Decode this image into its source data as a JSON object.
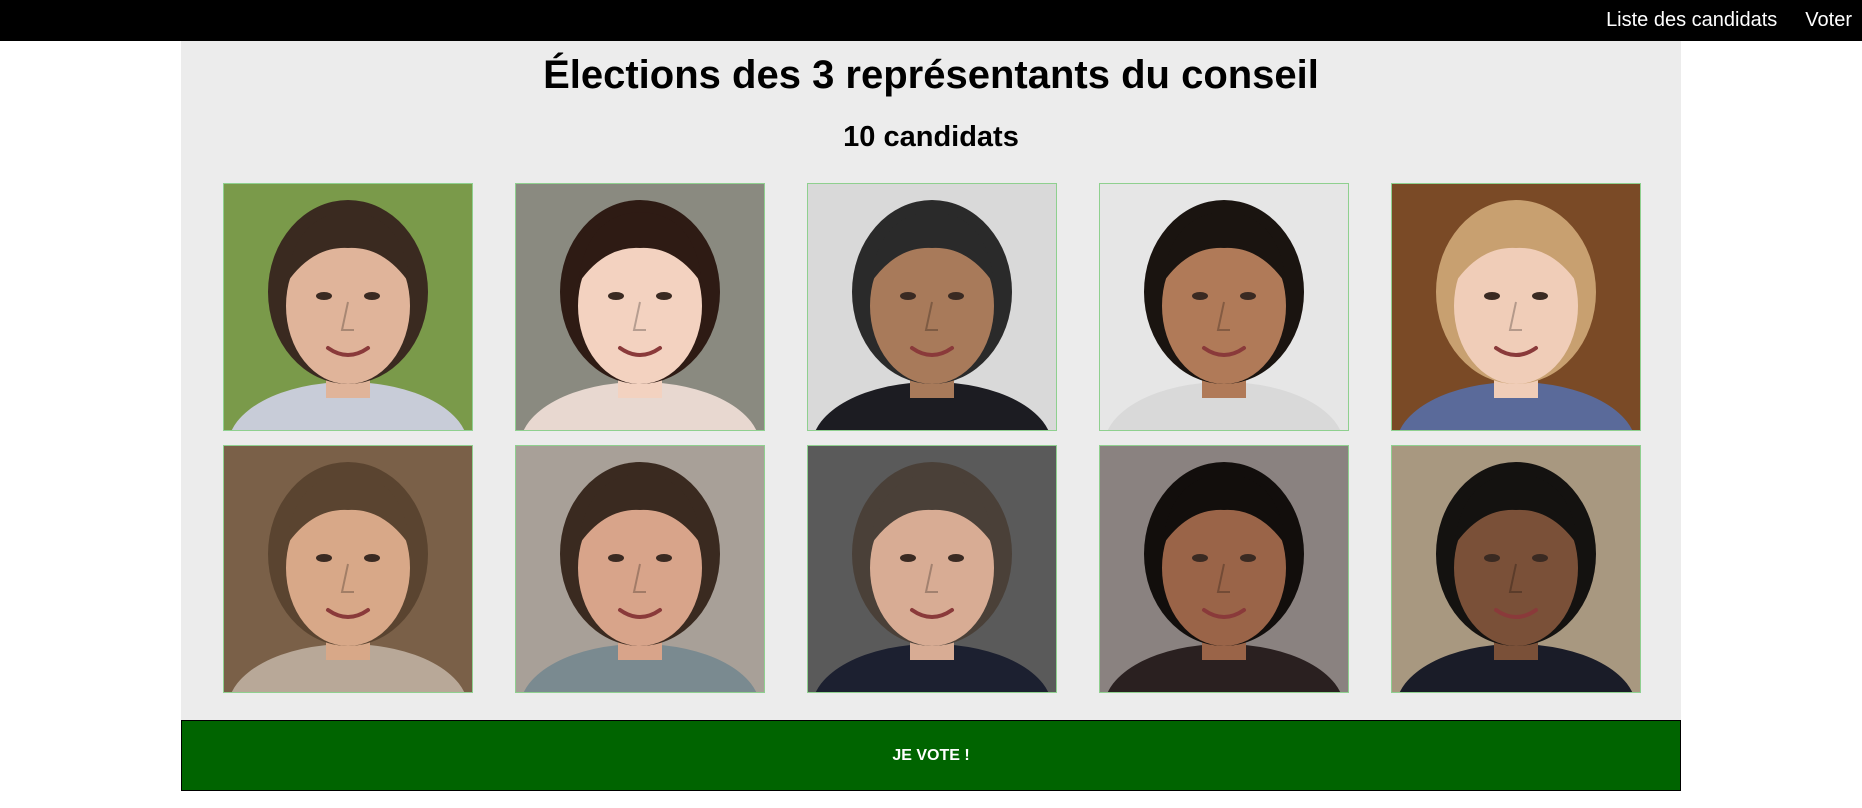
{
  "nav": {
    "candidates_link": "Liste des candidats",
    "vote_link": "Voter"
  },
  "header": {
    "title": "Élections des 3 représentants du conseil",
    "subtitle": "10 candidats"
  },
  "candidates": [
    {
      "photo": "woman-curly-brown-hair-portrait",
      "bg": "#7a9a4a",
      "skin": "#e0b49a",
      "hair": "#3a2a20",
      "shirt": "#c8ccd8"
    },
    {
      "photo": "woman-long-dark-hair-bangs-portrait",
      "bg": "#8a8a80",
      "skin": "#f3d2c0",
      "hair": "#2e1b14",
      "shirt": "#e8d8d0"
    },
    {
      "photo": "man-glasses-mustache-portrait",
      "bg": "#d9d9d9",
      "skin": "#a87a5a",
      "hair": "#2a2a2a",
      "shirt": "#1c1c22"
    },
    {
      "photo": "woman-curly-black-hair-portrait",
      "bg": "#e6e6e6",
      "skin": "#b07a58",
      "hair": "#1a1410",
      "shirt": "#d9d9d9"
    },
    {
      "photo": "woman-blonde-hair-portrait",
      "bg": "#7a4a26",
      "skin": "#f0cdb8",
      "hair": "#c8a070",
      "shirt": "#5a6a9a"
    },
    {
      "photo": "man-short-brown-hair-scarf-portrait",
      "bg": "#7a6048",
      "skin": "#d8a888",
      "hair": "#5a4430",
      "shirt": "#b8a898"
    },
    {
      "photo": "man-glasses-beard-portrait",
      "bg": "#a8a098",
      "skin": "#d8a48a",
      "hair": "#3a2a20",
      "shirt": "#7a8a90"
    },
    {
      "photo": "man-suit-grey-hair-portrait",
      "bg": "#5a5a5a",
      "skin": "#d8ac94",
      "hair": "#4a4038",
      "shirt": "#1c2030"
    },
    {
      "photo": "woman-long-black-hair-earrings-portrait",
      "bg": "#8a8280",
      "skin": "#9a6448",
      "hair": "#120e0c",
      "shirt": "#2a2020"
    },
    {
      "photo": "man-short-black-hair-portrait",
      "bg": "#a89880",
      "skin": "#7a5038",
      "hair": "#141210",
      "shirt": "#1a1c28"
    }
  ],
  "vote_button": {
    "label": "JE VOTE !"
  },
  "colors": {
    "topbar": "#000000",
    "panel": "#ececec",
    "vote_button": "#006400",
    "card_border": "#8fd08f"
  }
}
